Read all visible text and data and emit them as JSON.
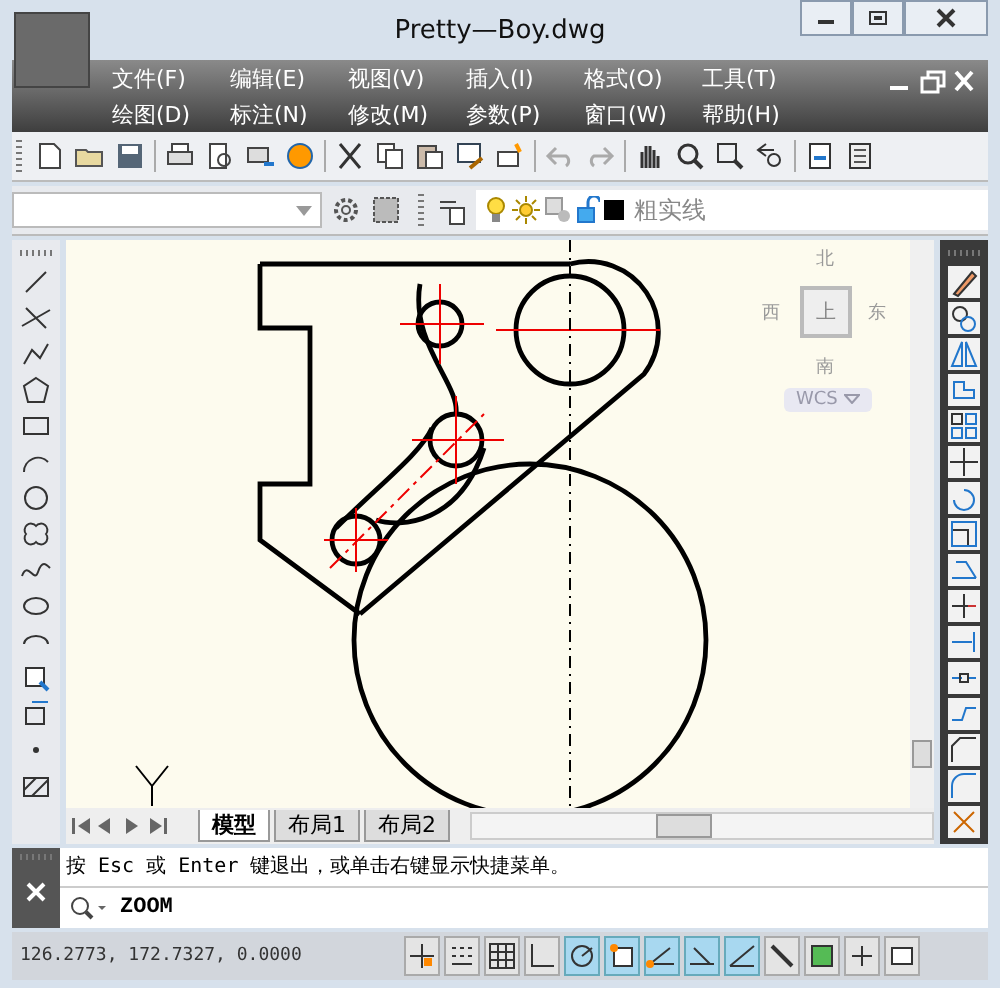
{
  "window": {
    "title": "Pretty—Boy.dwg"
  },
  "menu_rows": [
    [
      "文件(F)",
      "编辑(E)",
      "视图(V)",
      "插入(I)",
      "格式(O)",
      "工具(T)"
    ],
    [
      "绘图(D)",
      "标注(N)",
      "修改(M)",
      "参数(P)",
      "窗口(W)",
      "帮助(H)"
    ]
  ],
  "layer_toolbar": {
    "layer_name": "粗实线"
  },
  "viewcube": {
    "north": "北",
    "east": "东",
    "south": "南",
    "west": "西",
    "face": "上",
    "ucs": "WCS"
  },
  "tabs": [
    {
      "label": "模型",
      "selected": true
    },
    {
      "label": "布局1",
      "selected": false
    },
    {
      "label": "布局2",
      "selected": false
    }
  ],
  "command_line": {
    "prompt": "按 Esc 或 Enter 键退出，或单击右键显示快捷菜单。",
    "input": "ZOOM"
  },
  "status_bar": {
    "coordinates": "126.2773, 172.7327, 0.0000",
    "toggles": [
      {
        "on": false
      },
      {
        "on": false
      },
      {
        "on": false
      },
      {
        "on": false
      },
      {
        "on": true
      },
      {
        "on": true
      },
      {
        "on": true
      },
      {
        "on": true
      },
      {
        "on": true
      },
      {
        "on": false
      },
      {
        "on": false
      },
      {
        "on": false
      },
      {
        "on": false
      }
    ]
  }
}
